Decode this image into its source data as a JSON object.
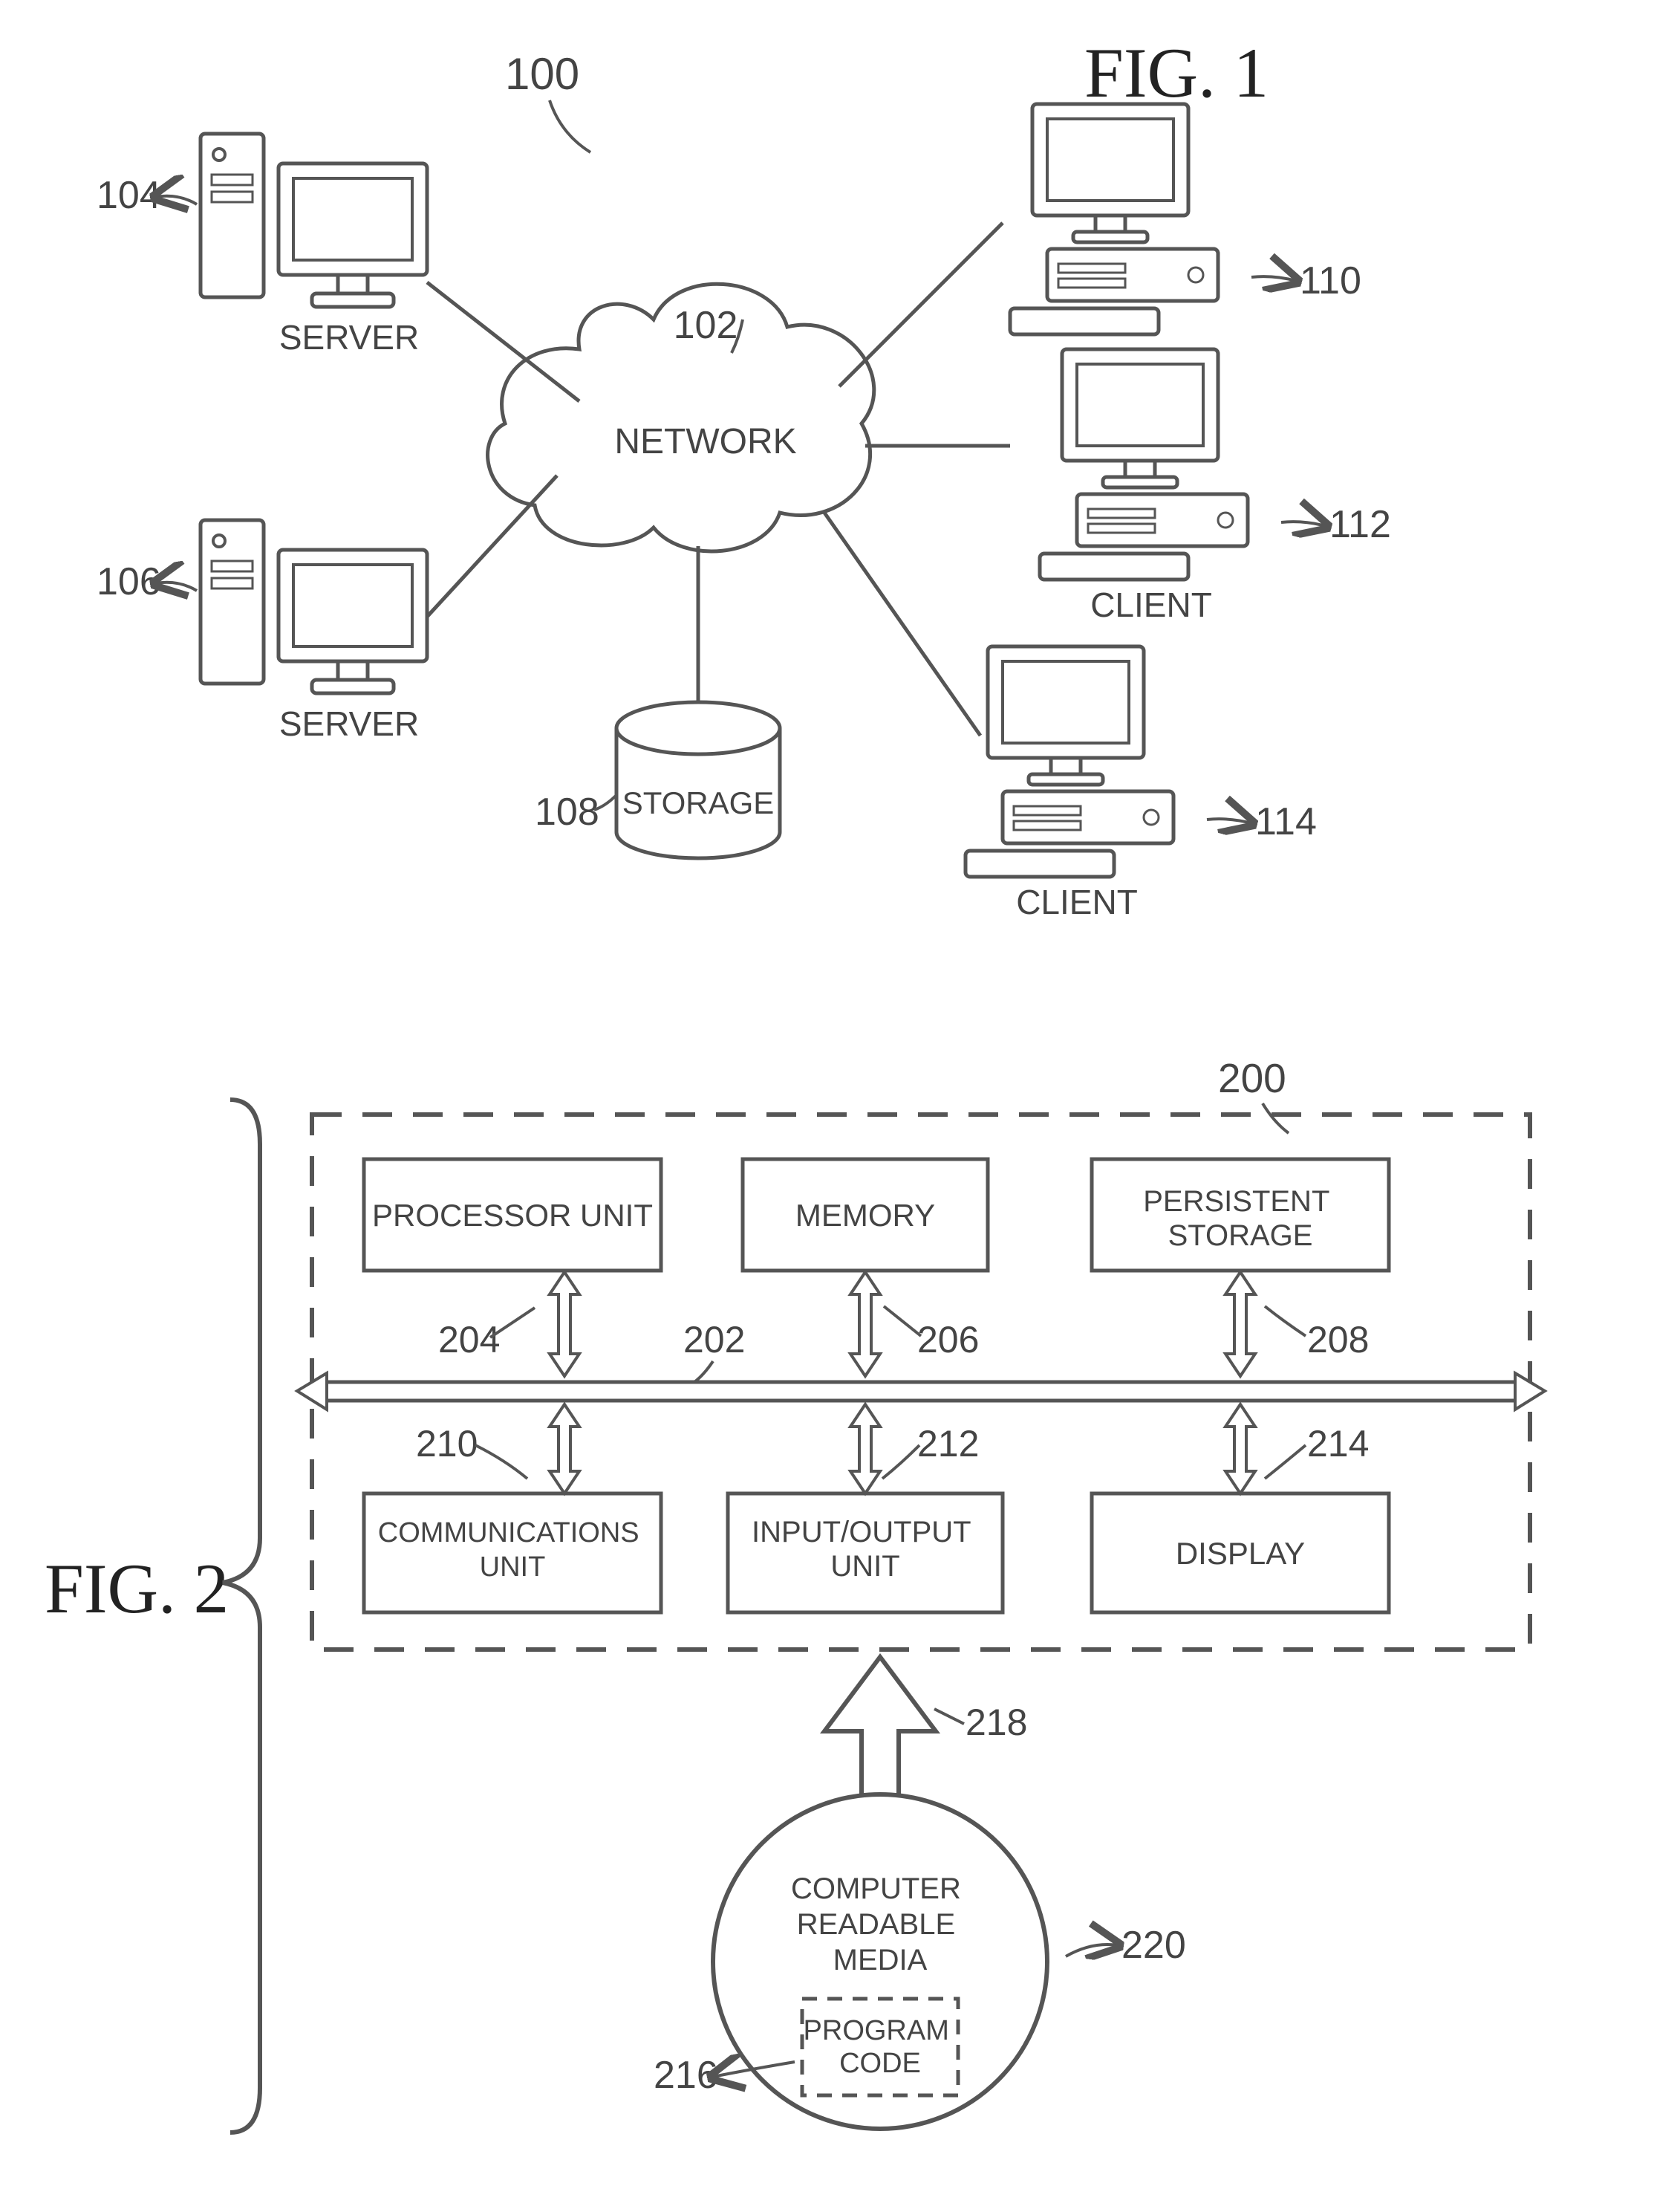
{
  "fig1": {
    "title": "FIG. 1",
    "ref_system": "100",
    "network": {
      "label": "NETWORK",
      "ref": "102"
    },
    "storage": {
      "label": "STORAGE",
      "ref": "108"
    },
    "servers": [
      {
        "label": "SERVER",
        "ref": "104"
      },
      {
        "label": "SERVER",
        "ref": "106"
      }
    ],
    "clients": [
      {
        "label": "CLIENT",
        "ref": "110"
      },
      {
        "label": "CLIENT",
        "ref": "112"
      },
      {
        "label": "CLIENT",
        "ref": "114"
      }
    ]
  },
  "fig2": {
    "title": "FIG. 2",
    "ref_system": "200",
    "bus_ref": "202",
    "blocks": {
      "processor": {
        "label": "PROCESSOR UNIT",
        "ref": "204"
      },
      "memory": {
        "label": "MEMORY",
        "ref": "206"
      },
      "persistent": {
        "label": "PERSISTENT STORAGE",
        "ref": "208"
      },
      "comms": {
        "label": "COMMUNICATIONS UNIT",
        "ref": "210"
      },
      "io": {
        "label": "INPUT/OUTPUT UNIT",
        "ref": "212"
      },
      "display": {
        "label": "DISPLAY",
        "ref": "214"
      }
    },
    "media": {
      "label": "COMPUTER READABLE MEDIA",
      "ref": "220"
    },
    "program": {
      "label": "PROGRAM CODE",
      "ref": "216"
    },
    "arrow_ref": "218"
  }
}
